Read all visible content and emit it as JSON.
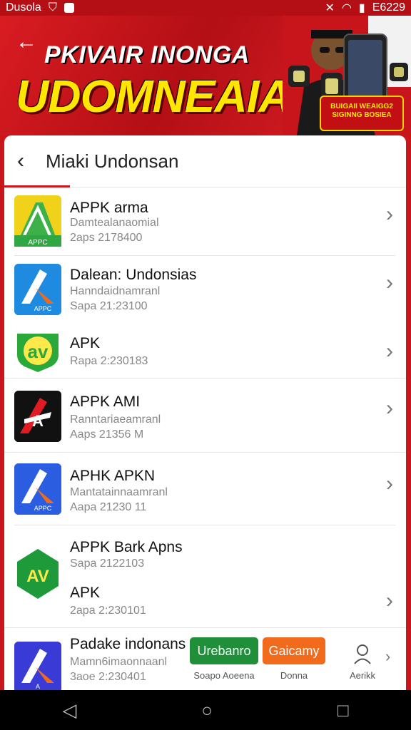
{
  "status_bar": {
    "left_text": "Dusola",
    "right_text": "E6229"
  },
  "banner": {
    "back_icon": "arrow-left-icon",
    "headline": "PKIVAIR INONGA",
    "big_title": "UDOMNEAIA",
    "badge_text": "BUIGAII WEAIGG2 SIGINNG BOSIEA"
  },
  "sheet": {
    "title": "Miaki Undonsan",
    "back_icon": "chevron-left-icon"
  },
  "apps": [
    {
      "name": "APPK arma",
      "dev": "Damtealanaomial",
      "meta": "2aps 2178400",
      "icon": "apk-green-a-icon",
      "icon_color": "#2fa844",
      "icon_text": "APPC"
    },
    {
      "name": "Dalean: Undonsias",
      "dev": "Hanndaidnamranl",
      "meta": "Sapa 21:23100",
      "icon": "apk-blue-a-icon",
      "icon_color": "#1f8be0",
      "icon_text": "APPC"
    },
    {
      "name": "APK",
      "dev": "",
      "meta": "Rapa 2:230183",
      "icon": "apk-green-av-icon",
      "icon_color": "#2aa93a",
      "icon_text": "av"
    },
    {
      "name": "APPK AMI",
      "dev": "Ranntariaeamranl",
      "meta": "Aaps 21356 M",
      "icon": "apk-black-a-icon",
      "icon_color": "#111111",
      "icon_text": "A"
    },
    {
      "name": "APHK APKN",
      "dev": "Mantatainnaamranl",
      "meta": "Aapa 21230 11",
      "icon": "apk-blue-a-icon",
      "icon_color": "#2a5de0",
      "icon_text": "APPC"
    },
    {
      "name": "APPK Bark Apns",
      "dev": "",
      "meta": "Sapa 2122103",
      "icon": "apk-green-av-icon",
      "icon_color": "#1f9a3a",
      "icon_text": "AV"
    },
    {
      "name": "APK",
      "dev": "",
      "meta": "2apa 2:230101",
      "icon": "",
      "icon_color": "",
      "icon_text": ""
    },
    {
      "name": "Padake indonans",
      "dev": "Mamn6imaonnaanl",
      "meta": "3aoe 2:230401",
      "icon": "apk-purple-a-icon",
      "icon_color": "#3a3ad6",
      "icon_text": "A"
    }
  ],
  "actions": {
    "button1": "Urebanro",
    "button1_color": "#1f8f3a",
    "label1": "Soapo Aoeena",
    "button2": "Gaicamy",
    "button2_color": "#f26a1b",
    "label2": "Donna",
    "profile_label": "Aerikk",
    "profile_icon": "person-icon"
  },
  "nav": {
    "back": "◁",
    "home": "○",
    "recent": "□"
  }
}
